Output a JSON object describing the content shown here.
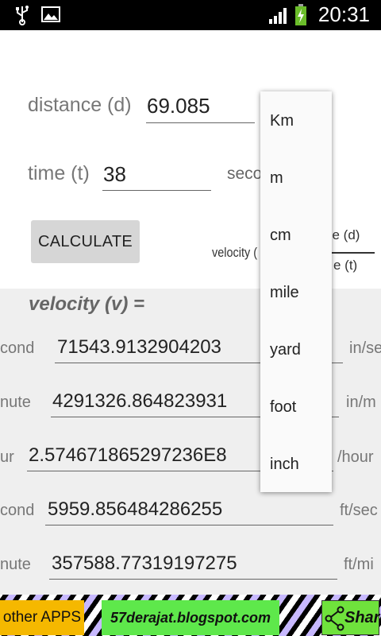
{
  "status": {
    "time": "20:31"
  },
  "inputs": {
    "distance_label": "distance (d)",
    "distance_value": "69.085",
    "time_label": "time (t)",
    "time_value": "38",
    "time_unit_partial": "seco"
  },
  "calculate_label": "CALCULATE",
  "formula": {
    "left_text": "velocity (",
    "numerator_text": "ce (d)",
    "denominator_text": "e (t)"
  },
  "velocity_title": "velocity (v) =",
  "results": [
    {
      "label": "cond",
      "value": "71543.9132904203",
      "unit": "in/se"
    },
    {
      "label": "nute",
      "value": "4291326.864823931",
      "unit": "in/m"
    },
    {
      "label": "ur",
      "value": "2.574671865297236E8",
      "unit": "/hour"
    },
    {
      "label": "cond",
      "value": "5959.856484286255",
      "unit": "ft/sec"
    },
    {
      "label": "nute",
      "value": "357588.77319197275",
      "unit": "ft/mi"
    }
  ],
  "dropdown": {
    "options": [
      "Km",
      "m",
      "cm",
      "mile",
      "yard",
      "foot",
      "inch"
    ]
  },
  "footer": {
    "apps_label": "other APPS",
    "blog_label": "57derajat.blogspot.com",
    "share_label": "Share"
  }
}
